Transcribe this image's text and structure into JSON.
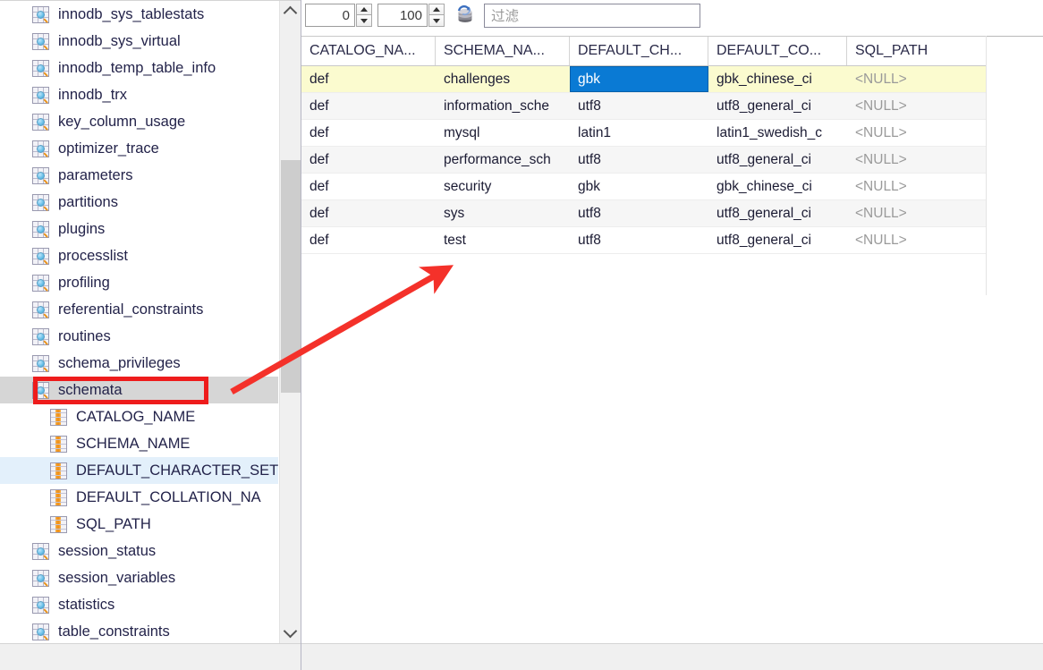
{
  "tree": {
    "items": [
      {
        "label": "innodb_sys_tablestats",
        "icon": "table-icon",
        "level": "table",
        "state": "normal"
      },
      {
        "label": "innodb_sys_virtual",
        "icon": "table-icon",
        "level": "table",
        "state": "normal"
      },
      {
        "label": "innodb_temp_table_info",
        "icon": "table-icon",
        "level": "table",
        "state": "normal"
      },
      {
        "label": "innodb_trx",
        "icon": "table-icon",
        "level": "table",
        "state": "normal"
      },
      {
        "label": "key_column_usage",
        "icon": "table-icon",
        "level": "table",
        "state": "normal"
      },
      {
        "label": "optimizer_trace",
        "icon": "table-icon",
        "level": "table",
        "state": "normal"
      },
      {
        "label": "parameters",
        "icon": "table-icon",
        "level": "table",
        "state": "normal"
      },
      {
        "label": "partitions",
        "icon": "table-icon",
        "level": "table",
        "state": "normal"
      },
      {
        "label": "plugins",
        "icon": "table-icon",
        "level": "table",
        "state": "normal"
      },
      {
        "label": "processlist",
        "icon": "table-icon",
        "level": "table",
        "state": "normal"
      },
      {
        "label": "profiling",
        "icon": "table-icon",
        "level": "table",
        "state": "normal"
      },
      {
        "label": "referential_constraints",
        "icon": "table-icon",
        "level": "table",
        "state": "normal"
      },
      {
        "label": "routines",
        "icon": "table-icon",
        "level": "table",
        "state": "normal"
      },
      {
        "label": "schema_privileges",
        "icon": "table-icon",
        "level": "table",
        "state": "normal"
      },
      {
        "label": "schemata",
        "icon": "table-icon",
        "level": "table",
        "state": "selected"
      },
      {
        "label": "CATALOG_NAME",
        "icon": "column-icon",
        "level": "column",
        "state": "normal"
      },
      {
        "label": "SCHEMA_NAME",
        "icon": "column-icon",
        "level": "column",
        "state": "normal"
      },
      {
        "label": "DEFAULT_CHARACTER_SET",
        "icon": "column-icon",
        "level": "column",
        "state": "highlighted"
      },
      {
        "label": "DEFAULT_COLLATION_NA",
        "icon": "column-icon",
        "level": "column",
        "state": "normal"
      },
      {
        "label": "SQL_PATH",
        "icon": "column-icon",
        "level": "column",
        "state": "normal"
      },
      {
        "label": "session_status",
        "icon": "table-icon",
        "level": "table",
        "state": "normal"
      },
      {
        "label": "session_variables",
        "icon": "table-icon",
        "level": "table",
        "state": "normal"
      },
      {
        "label": "statistics",
        "icon": "table-icon",
        "level": "table",
        "state": "normal"
      },
      {
        "label": "table_constraints",
        "icon": "table-icon",
        "level": "table",
        "state": "normal"
      }
    ],
    "scrollbar": {
      "up_icon": "chevron-up-icon",
      "down_icon": "chevron-down-icon"
    }
  },
  "toolbar": {
    "offset_value": "0",
    "limit_value": "100",
    "refresh_icon": "refresh-data-icon",
    "filter_placeholder": "过滤",
    "filter_value": ""
  },
  "grid": {
    "columns": [
      {
        "label": "CATALOG_NA...",
        "full": "CATALOG_NAME",
        "sorted": false
      },
      {
        "label": "SCHEMA_NA...",
        "full": "SCHEMA_NAME",
        "sorted": true
      },
      {
        "label": "DEFAULT_CH...",
        "full": "DEFAULT_CHARACTER_SET_NAME",
        "sorted": false
      },
      {
        "label": "DEFAULT_CO...",
        "full": "DEFAULT_COLLATION_NAME",
        "sorted": false
      },
      {
        "label": "SQL_PATH",
        "full": "SQL_PATH",
        "sorted": false
      }
    ],
    "rows": [
      {
        "cells": [
          "def",
          "challenges",
          "gbk",
          "gbk_chinese_ci",
          "<NULL>"
        ],
        "row_state": "current",
        "selected_cell": 2
      },
      {
        "cells": [
          "def",
          "information_sche",
          "utf8",
          "utf8_general_ci",
          "<NULL>"
        ],
        "row_state": "odd",
        "selected_cell": -1
      },
      {
        "cells": [
          "def",
          "mysql",
          "latin1",
          "latin1_swedish_c",
          "<NULL>"
        ],
        "row_state": "even",
        "selected_cell": -1
      },
      {
        "cells": [
          "def",
          "performance_sch",
          "utf8",
          "utf8_general_ci",
          "<NULL>"
        ],
        "row_state": "odd",
        "selected_cell": -1
      },
      {
        "cells": [
          "def",
          "security",
          "gbk",
          "gbk_chinese_ci",
          "<NULL>"
        ],
        "row_state": "even",
        "selected_cell": -1
      },
      {
        "cells": [
          "def",
          "sys",
          "utf8",
          "utf8_general_ci",
          "<NULL>"
        ],
        "row_state": "odd",
        "selected_cell": -1
      },
      {
        "cells": [
          "def",
          "test",
          "utf8",
          "utf8_general_ci",
          "<NULL>"
        ],
        "row_state": "even",
        "selected_cell": -1
      }
    ]
  },
  "annotations": {
    "highlight_color": "#ee1c1c",
    "arrow_color": "#f4312a",
    "highlight_target": "schemata",
    "arrow_from": "schemata",
    "arrow_to": "grid-data-area"
  },
  "colors": {
    "selected_cell_bg": "#0a7ad4",
    "current_row_bg": "#fbfbcf",
    "tree_selected_bg": "#d6d6d6",
    "tree_highlight_bg": "#e3f0fb",
    "null_text": "#9a9a9a"
  }
}
